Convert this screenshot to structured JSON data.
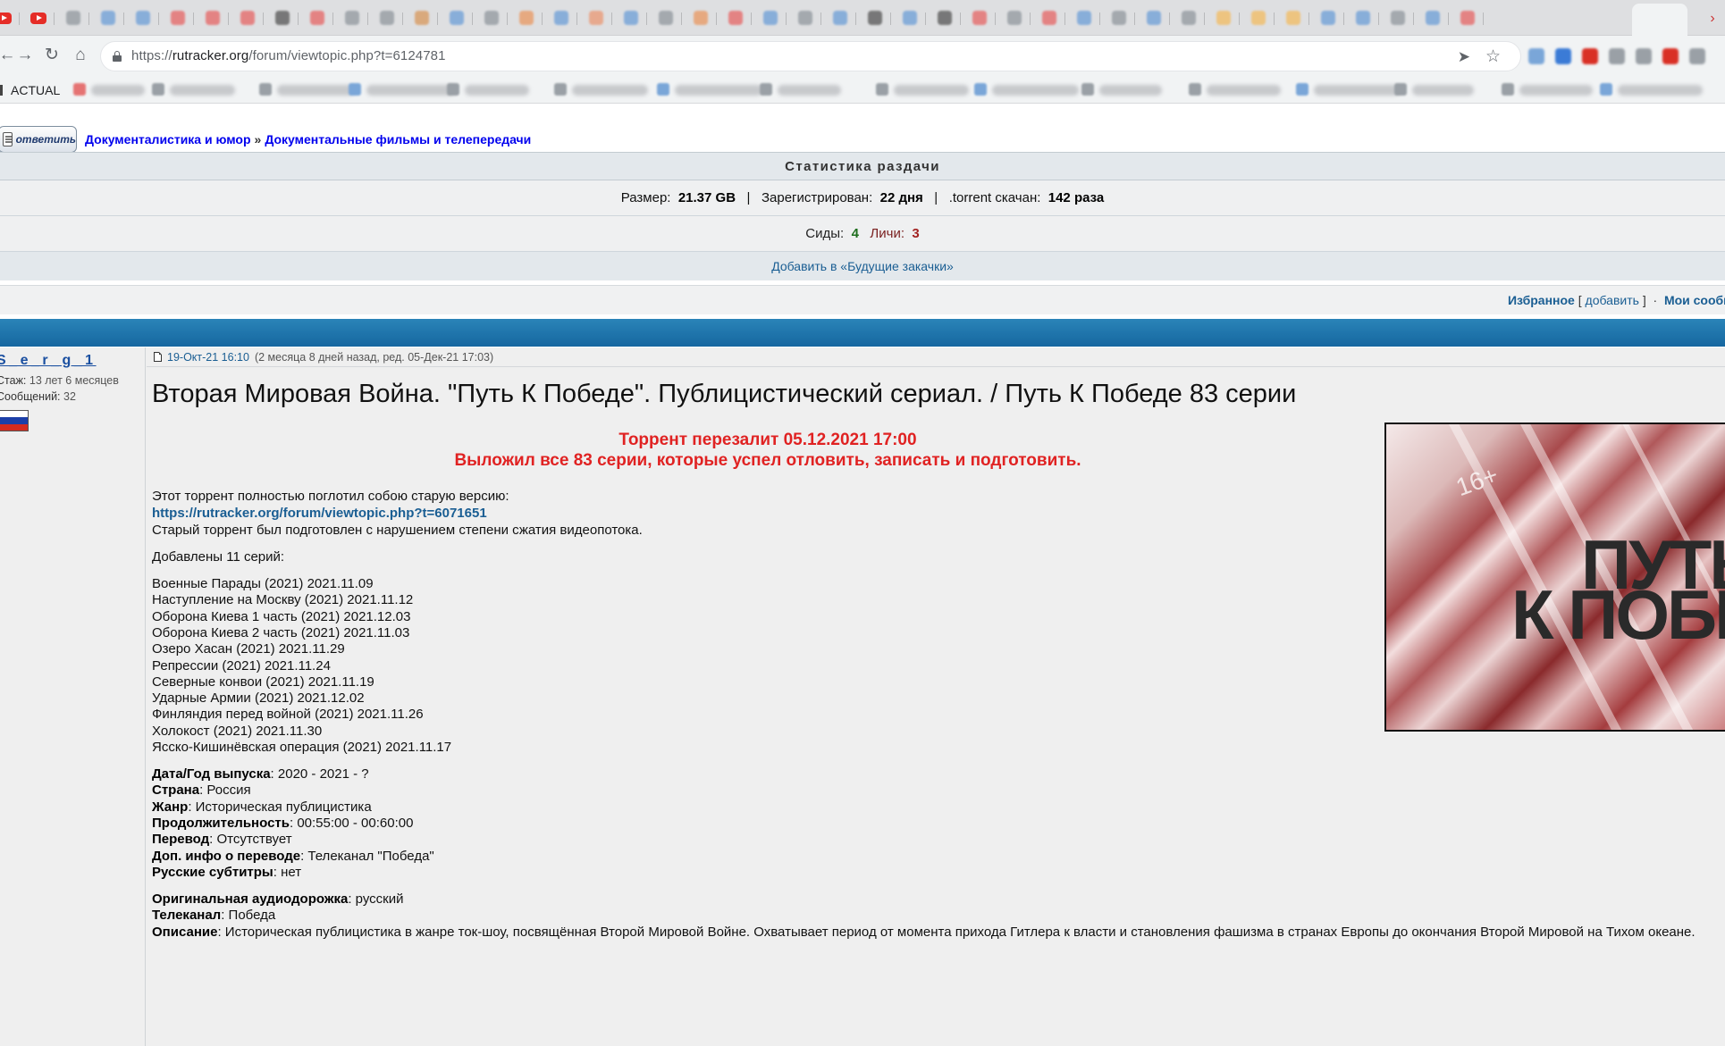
{
  "browser": {
    "url_prefix": "https://",
    "url_host": "rutracker.org",
    "url_path": "/forum/viewtopic.php?t=6124781",
    "bookmark_folder": "ACTUAL"
  },
  "page": {
    "reply_button": "ответить",
    "breadcrumb": [
      "Документалистика и юмор",
      "Документальные фильмы и телепередачи"
    ],
    "breadcrumb_sep": "»",
    "stats": {
      "title": "Статистика раздачи",
      "size_label": "Размер:",
      "size_value": "21.37 GB",
      "registered_label": "Зарегистрирован:",
      "registered_value": "22 дня",
      "downloaded_label": ".torrent скачан:",
      "downloaded_value": "142 раза",
      "seeds_label": "Сиды:",
      "seeds_value": "4",
      "leechers_label": "Личи:",
      "leechers_value": "3",
      "future_downloads": "Добавить в «Будущие закачки»"
    },
    "favbar": {
      "favorites": "Избранное",
      "add": "добавить",
      "my_messages": "Мои сообщ"
    },
    "author": {
      "name": "S_e_r_g_1",
      "stage_label": "Стаж:",
      "stage_value": "13 лет 6 месяцев",
      "posts_label": "Сообщений:",
      "posts_value": "32"
    },
    "post": {
      "date": "19-Окт-21 16:10",
      "ago": "(2 месяца 8 дней назад, ред. 05-Дек-21 17:03)",
      "title": "Вторая Мировая Война. \"Путь К Победе\". Публицистический сериал. / Путь К Победе 83 серии",
      "red_line1": "Торрент перезалит 05.12.2021 17:00",
      "red_line2": "Выложил все 83 серии, которые успел отловить, записать и подготовить.",
      "intro1": "Этот торрент полностью поглотил собою старую версию:",
      "old_link": "https://rutracker.org/forum/viewtopic.php?t=6071651",
      "intro2": "Старый торрент был подготовлен с нарушением степени сжатия видеопотока.",
      "added_header": "Добавлены 11 серий:",
      "episodes": [
        "Военные Парады (2021) 2021.11.09",
        "Наступление на Москву (2021) 2021.11.12",
        "Оборона Киева 1 часть (2021) 2021.12.03",
        "Оборона Киева 2 часть (2021) 2021.11.03",
        "Озеро Хасан (2021) 2021.11.29",
        "Репрессии (2021) 2021.11.24",
        "Северные конвои (2021) 2021.11.19",
        "Ударные Армии (2021) 2021.12.02",
        "Финляндия перед войной (2021) 2021.11.26",
        "Холокост (2021) 2021.11.30",
        "Ясско-Кишинёвская операция (2021) 2021.11.17"
      ],
      "specs": [
        {
          "k": "Дата/Год выпуска",
          "v": ": 2020 - 2021 - ?"
        },
        {
          "k": "Страна",
          "v": ": Россия"
        },
        {
          "k": "Жанр",
          "v": ": Историческая публицистика"
        },
        {
          "k": "Продолжительность",
          "v": ": 00:55:00 - 00:60:00"
        },
        {
          "k": "Перевод",
          "v": ": Отсутствует"
        },
        {
          "k": "Доп. инфо о переводе",
          "v": ": Телеканал \"Победа\""
        },
        {
          "k": "Русские субтитры",
          "v": ": нет"
        }
      ],
      "specs2": [
        {
          "k": "Оригинальная аудиодорожка",
          "v": ": русский"
        },
        {
          "k": "Телеканал",
          "v": ": Победа"
        },
        {
          "k": "Описание",
          "v": ": Историческая публицистика в жанре ток-шоу, посвящённая Второй Мировой Войне. Охватывает период от момента прихода Гитлера к власти и становления фашизма в странах Европы до окончания Второй Мировой на Тихом океане."
        }
      ],
      "cover": {
        "line1": "ПУТЬ",
        "line2": "К ПОБЕДЕ",
        "age": "16+"
      }
    }
  }
}
